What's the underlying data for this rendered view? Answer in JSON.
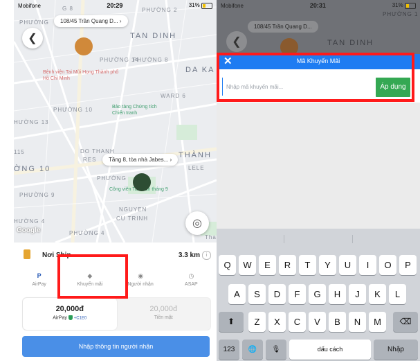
{
  "left_screen": {
    "status": {
      "carrier": "Mobifone",
      "time": "20:29",
      "battery": "31%"
    },
    "pickup_address": "108/45 Trần Quang D...",
    "dropoff_address": "Tầng 8, tòa nhà Jabes...",
    "map_labels": {
      "phuong_2_top": "PHƯỜNG 2",
      "phuong_top_left": "PHƯỜNG",
      "g8": "G 8",
      "tan_dinh": "TAN DINH",
      "phuong_14": "PHƯỜNG 14",
      "phuong_8": "PHƯỜNG 8",
      "da_ka": "DA KA",
      "ward_6": "WARD 6",
      "phuong_10": "PHƯỜNG 10",
      "huong_13": "HƯỜNG 13",
      "do_thanh": "DO THANH",
      "res": "RES",
      "thanh": "THÀNH",
      "ong_10": "ỜNG 10",
      "phuong_mid": "PHƯỜNG",
      "phuong_9": "PHƯỜNG 9",
      "nguyen": "NGUYEN",
      "cu_trinh": "CU TRINH",
      "phuong_4": "PHƯỜNG 4",
      "huong_4": "HƯỜNG 4",
      "num_115": "115",
      "lele": "LELE",
      "tha": "Tha"
    },
    "pois": {
      "hospital": "Bệnh viện Tai Mũi Họng Thành phố Hồ Chí Minh",
      "museum": "Bảo tàng Chứng tích Chiến tranh",
      "park": "Công viên Tao Đàn tháng 9"
    },
    "google": "Google",
    "service": {
      "name": "Nơi Ship",
      "distance": "3.3 km",
      "info": "i"
    },
    "options": [
      "AirPay",
      "Khuyến mãi",
      "Người nhận",
      "ASAP"
    ],
    "payment": {
      "airpay_amount": "20,000đ",
      "airpay_label": "AirPay",
      "airpay_sub": "+C1E0",
      "cash_amount": "20,000đ",
      "cash_label": "Tiền mặt"
    },
    "cta": "Nhập thông tin người nhận"
  },
  "right_screen": {
    "status": {
      "carrier": "Mobifone",
      "time": "20:31",
      "battery": "31%"
    },
    "bg_address": "108/45 Trần Quang D...",
    "bg_labels": {
      "phuong_1": "PHƯỜNG 1",
      "tan_dinh": "TAN DINH"
    },
    "promo": {
      "title": "Mã Khuyến Mãi",
      "close": "✕",
      "placeholder": "Nhập mã khuyến mãi...",
      "apply": "Áp dụng"
    },
    "keyboard": {
      "row1": [
        "Q",
        "W",
        "E",
        "R",
        "T",
        "Y",
        "U",
        "I",
        "O",
        "P"
      ],
      "row2": [
        "A",
        "S",
        "D",
        "F",
        "G",
        "H",
        "J",
        "K",
        "L"
      ],
      "row3": [
        "Z",
        "X",
        "C",
        "V",
        "B",
        "N",
        "M"
      ],
      "shift": "⬆",
      "backspace": "⌫",
      "num": "123",
      "globe": "🌐",
      "mic": "🎙",
      "space": "dấu cách",
      "enter": "Nhập"
    }
  },
  "colors": {
    "accent_blue": "#1e7cf2",
    "apply_green": "#34a853",
    "highlight": "#ff1a1a",
    "cta_blue": "#4a8fe7"
  }
}
